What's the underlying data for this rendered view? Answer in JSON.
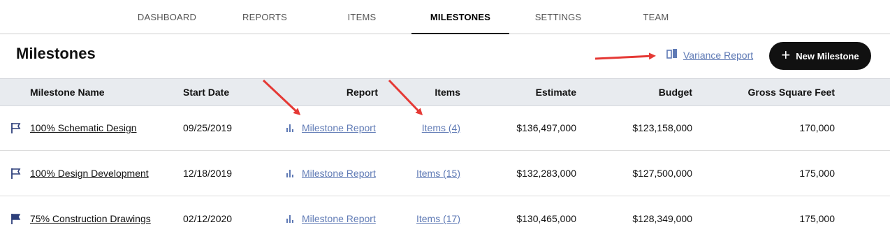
{
  "nav": {
    "tabs": [
      {
        "label": "DASHBOARD"
      },
      {
        "label": "REPORTS"
      },
      {
        "label": "ITEMS"
      },
      {
        "label": "MILESTONES"
      },
      {
        "label": "SETTINGS"
      },
      {
        "label": "TEAM"
      }
    ],
    "active_tab": "MILESTONES"
  },
  "header": {
    "title": "Milestones",
    "variance_link": "Variance Report",
    "new_button": "New Milestone"
  },
  "table": {
    "columns": [
      "Milestone Name",
      "Start Date",
      "Report",
      "Items",
      "Estimate",
      "Budget",
      "Gross Square Feet"
    ],
    "rows": [
      {
        "name": "100% Schematic Design",
        "start": "09/25/2019",
        "report": "Milestone Report",
        "items": "Items (4)",
        "estimate": "$136,497,000",
        "budget": "$123,158,000",
        "gsf": "170,000",
        "flag": "outline"
      },
      {
        "name": "100% Design Development",
        "start": "12/18/2019",
        "report": "Milestone Report",
        "items": "Items (15)",
        "estimate": "$132,283,000",
        "budget": "$127,500,000",
        "gsf": "175,000",
        "flag": "outline"
      },
      {
        "name": "75% Construction Drawings",
        "start": "02/12/2020",
        "report": "Milestone Report",
        "items": "Items (17)",
        "estimate": "$130,465,000",
        "budget": "$128,349,000",
        "gsf": "175,000",
        "flag": "filled"
      }
    ]
  },
  "colors": {
    "link_blue": "#5f7ab5",
    "header_bg": "#e8ebef",
    "flag": "#2d3f7a",
    "annotation_arrow": "#e53935"
  }
}
